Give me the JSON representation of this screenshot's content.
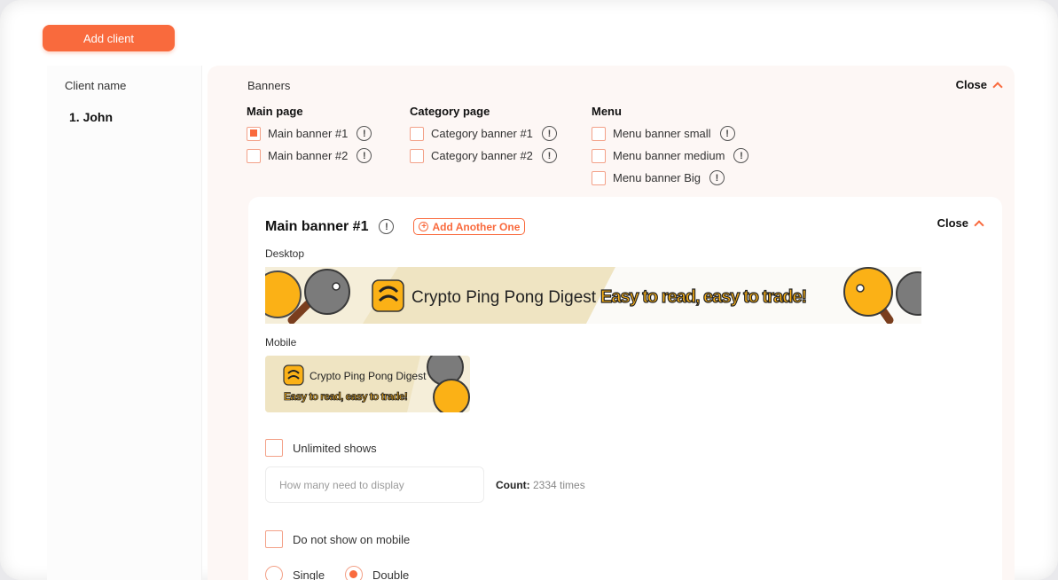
{
  "toolbar": {
    "add_client_label": "Add client"
  },
  "clients": {
    "header": "Client name",
    "items": [
      {
        "number": "1.",
        "name": "John"
      }
    ]
  },
  "banners": {
    "title": "Banners",
    "close_label": "Close",
    "groups": [
      {
        "title": "Main page",
        "options": [
          {
            "label": "Main banner #1",
            "checked": true
          },
          {
            "label": "Main banner #2",
            "checked": false
          }
        ]
      },
      {
        "title": "Category page",
        "options": [
          {
            "label": "Category banner #1",
            "checked": false
          },
          {
            "label": "Category banner #2",
            "checked": false
          }
        ]
      },
      {
        "title": "Menu",
        "options": [
          {
            "label": "Menu banner small",
            "checked": false
          },
          {
            "label": "Menu banner medium",
            "checked": false
          },
          {
            "label": "Menu banner Big",
            "checked": false
          }
        ]
      }
    ]
  },
  "detail": {
    "title": "Main banner #1",
    "add_another_label": "Add Another One",
    "close_label": "Close",
    "desktop_label": "Desktop",
    "mobile_label": "Mobile",
    "banner": {
      "brand": "Crypto Ping Pong Digest",
      "tagline": "Easy to read, easy to trade!"
    },
    "unlimited_label": "Unlimited shows",
    "display_placeholder": "How many need to display",
    "count_label": "Count:",
    "count_value": "2334 times",
    "no_mobile_label": "Do not show on mobile",
    "radio": {
      "single": "Single",
      "double": "Double",
      "selected": "Double"
    }
  },
  "colors": {
    "accent": "#f96a3d",
    "paddle_orange": "#fbb116",
    "paddle_gray": "#7b7b7b",
    "banner_bg": "#f5eed9"
  }
}
